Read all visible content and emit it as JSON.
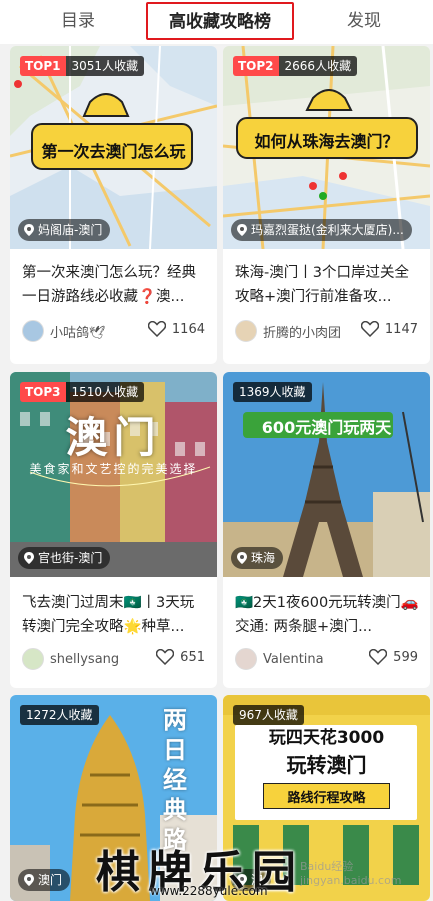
{
  "tabs": [
    {
      "label": "目录"
    },
    {
      "label": "高收藏攻略榜"
    },
    {
      "label": "发现"
    }
  ],
  "cards": [
    {
      "rank": "TOP1",
      "favorites": "3051人收藏",
      "cover_text": "第一次去澳门怎么玩",
      "location": "妈阁庙-澳门",
      "title": "第一次来澳门怎么玩？经典一日游路线必收藏❓澳...",
      "user": "小咕鸽🕊",
      "likes": "1164"
    },
    {
      "rank": "TOP2",
      "favorites": "2666人收藏",
      "cover_text": "如何从珠海去澳门？",
      "location": "玛嘉烈蛋挞(金利来大厦店)...",
      "title": "珠海-澳门丨3个口岸过关全攻略+澳门行前准备攻...",
      "user": "折腾的小肉团",
      "likes": "1147"
    },
    {
      "rank": "TOP3",
      "favorites": "1510人收藏",
      "cover_text": "澳门",
      "cover_sub": "美食家和文艺控的完美选择",
      "location": "官也街-澳门",
      "title": "飞去澳门过周末🇲🇴丨3天玩转澳门完全攻略🌟种草...",
      "user": "shellysang",
      "likes": "651"
    },
    {
      "rank": "",
      "favorites": "1369人收藏",
      "cover_text": "600元澳门玩两天",
      "location": "珠海",
      "title": "🇲🇴2天1夜600元玩转澳门🚗交通: 两条腿+澳门...",
      "user": "Valentina",
      "likes": "599"
    },
    {
      "rank": "",
      "favorites": "1272人收藏",
      "cover_text": "两日经典路线",
      "location": "澳门"
    },
    {
      "rank": "",
      "favorites": "967人收藏",
      "cover_text": "玩四天花3000",
      "cover_text2": "玩转澳门",
      "cover_text3": "路线行程攻略",
      "location": "澳"
    }
  ],
  "watermark": {
    "big": "棋牌乐园",
    "small": "www.2288yule.com",
    "faint": "Baidu经验 jingyan.baidu.com"
  },
  "colors": {
    "accent_red": "#e0191e",
    "top_badge": "#ff4a4a",
    "yellow": "#f7d23c",
    "green": "#3aa33a"
  }
}
